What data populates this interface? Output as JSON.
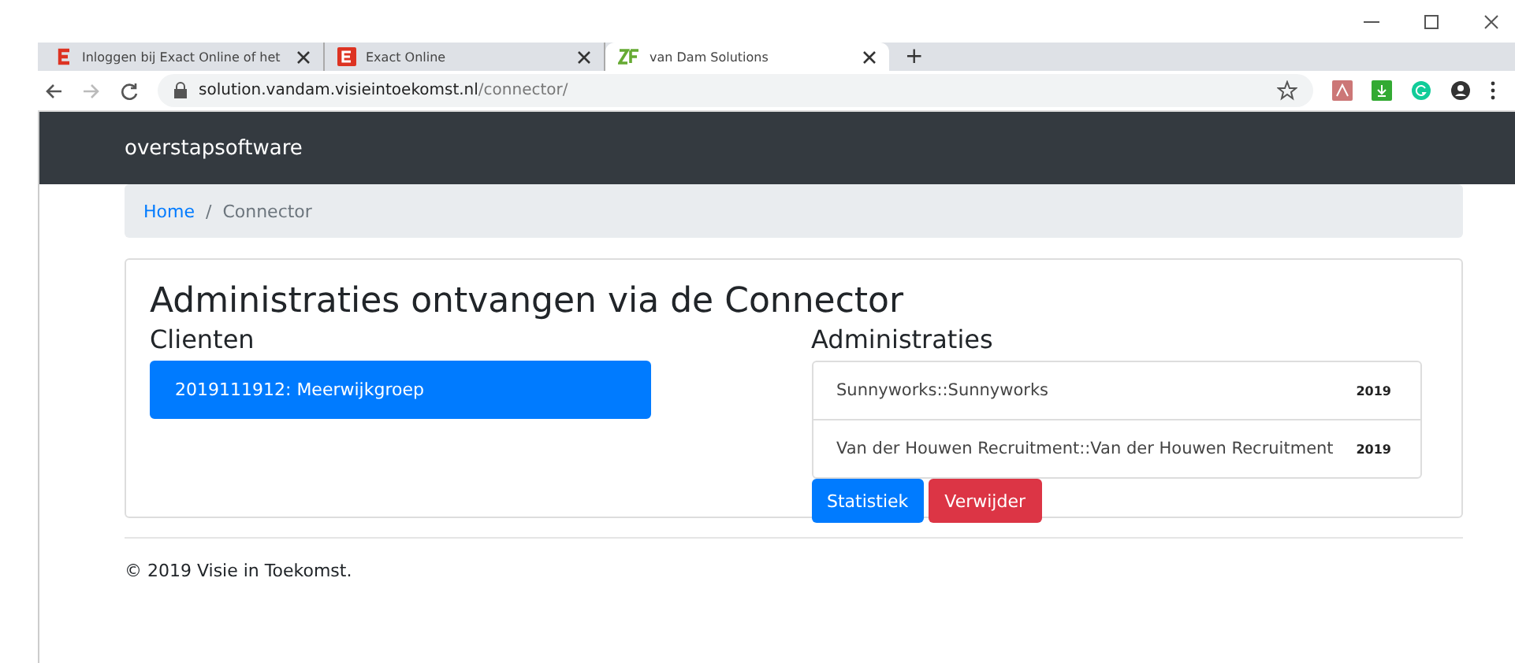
{
  "browser": {
    "tabs": [
      {
        "title": "Inloggen bij Exact Online of het",
        "kind": "e-letter",
        "selected": false
      },
      {
        "title": "Exact Online",
        "kind": "e-box",
        "selected": false
      },
      {
        "title": "van Dam Solutions",
        "kind": "zf",
        "selected": true
      }
    ],
    "new_tab": "+",
    "url_host": "solution.vandam.visieintoekomst.nl",
    "url_path": "/connector/"
  },
  "navbar": {
    "brand": "overstapsoftware"
  },
  "breadcrumb": [
    {
      "label": "Home",
      "kind": "link"
    },
    {
      "label": "/",
      "kind": "separator"
    },
    {
      "label": "Connector",
      "kind": "current"
    }
  ],
  "page": {
    "title": "Administraties ontvangen via de Connector",
    "clients": {
      "heading": "Clienten",
      "items": [
        {
          "label": "2019111912: Meerwijkgroep",
          "selected": true
        }
      ]
    },
    "administrations": {
      "heading": "Administraties",
      "items": [
        {
          "name": "Sunnyworks::Sunnyworks",
          "badge": "2019"
        },
        {
          "name": "Van der Houwen Recruitment::Van der Houwen Recruitment",
          "badge": "2019"
        }
      ]
    },
    "buttons": [
      {
        "label": "Statistiek",
        "kind": "primary"
      },
      {
        "label": "Verwijder",
        "kind": "danger"
      }
    ]
  },
  "footer": "© 2019 Visie in Toekomst."
}
